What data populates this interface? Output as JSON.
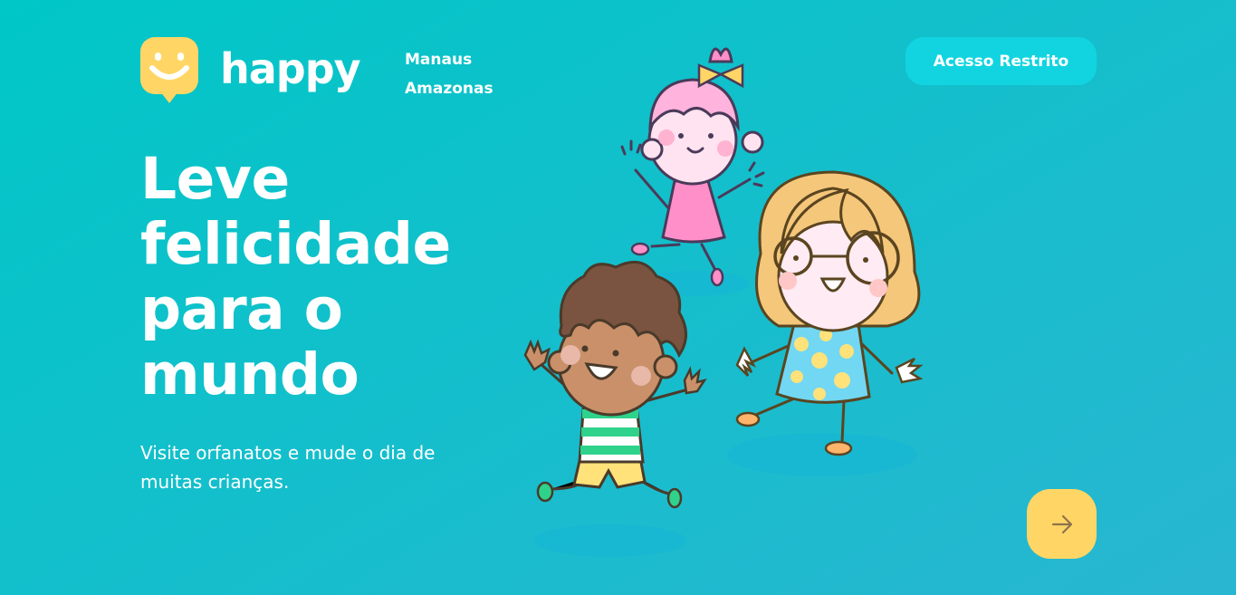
{
  "brand": {
    "name": "happy"
  },
  "location": {
    "city": "Manaus",
    "state": "Amazonas"
  },
  "nav": {
    "restricted_access": "Acesso Restrito"
  },
  "hero": {
    "title": "Leve felicidade para o mundo",
    "subtitle": "Visite orfanatos e mude o dia de muitas crianças."
  },
  "icons": {
    "logo": "smiley-pin-icon",
    "enter": "arrow-right-icon"
  },
  "colors": {
    "accent_yellow": "#FFD666",
    "button_cyan": "#12D4E0",
    "background_start": "#00C7C7",
    "background_end": "#29B6D1"
  }
}
